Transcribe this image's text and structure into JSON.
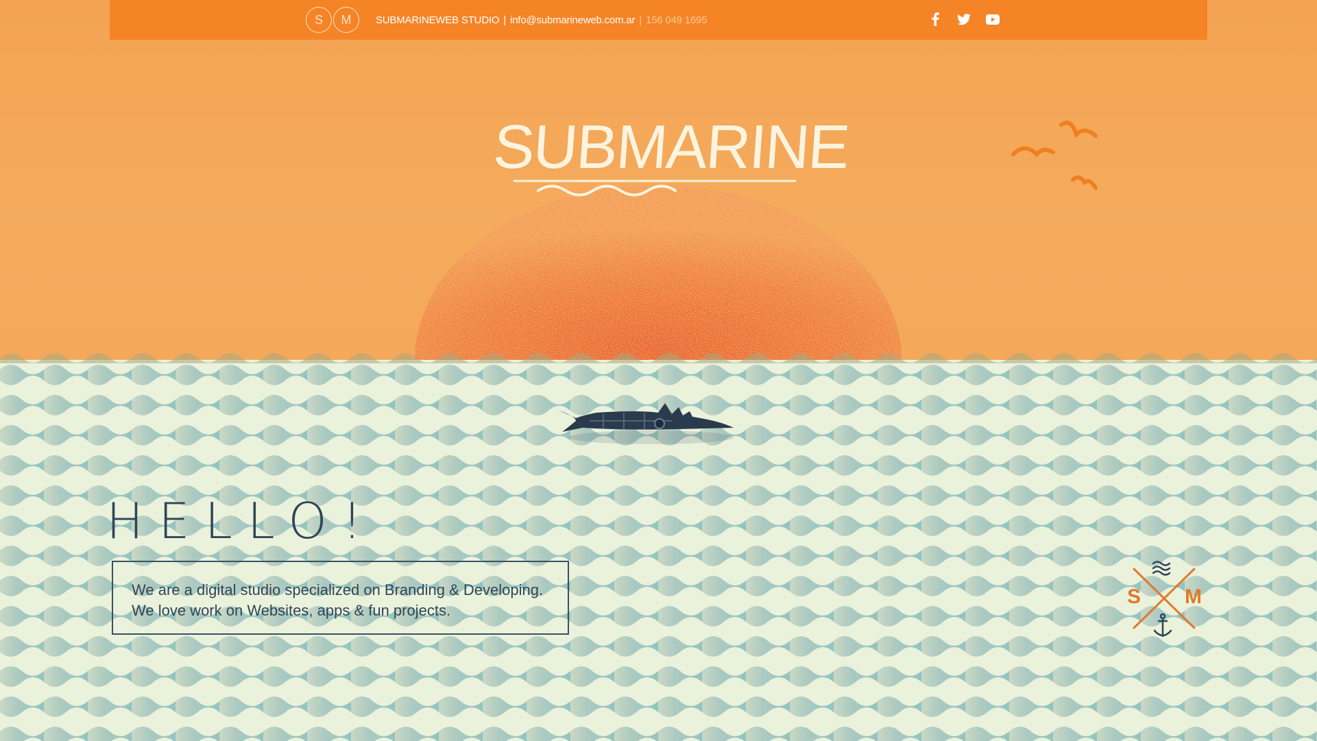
{
  "header": {
    "logo_letters": [
      "S",
      "M"
    ],
    "studio_name": "SUBMARINEWEB STUDIO",
    "separator": "|",
    "email": "info@submarineweb.com.ar",
    "phone_separator": "|",
    "phone": "156 049 1695",
    "socials": [
      {
        "name": "facebook-icon"
      },
      {
        "name": "twitter-icon"
      },
      {
        "name": "youtube-icon"
      }
    ]
  },
  "hero": {
    "brand": "SUBMARINE"
  },
  "content": {
    "heading": "HELLO!",
    "intro_lines": [
      "We are a digital studio specialized on Branding & Developing.",
      "We love work on Websites, apps & fun projects."
    ]
  },
  "emblem": {
    "letters": [
      "S",
      "M"
    ]
  },
  "colors": {
    "sky": "#f4a85a",
    "topbar": "#f58426",
    "sun": "#ec6a1e",
    "sea_light": "#eaf2dc",
    "sea_wave": "#9fc7c3",
    "ink": "#2f4557",
    "emblem_orange": "#e07a2a"
  }
}
